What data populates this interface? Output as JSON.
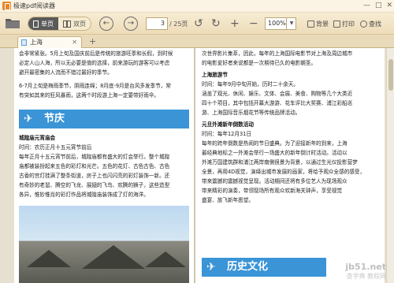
{
  "app": {
    "title": "极速pdf阅读器",
    "win_controls": [
      "—",
      "□",
      "✕"
    ]
  },
  "toolbar": {
    "view_single": "单页",
    "view_double": "双页",
    "page_current": "3",
    "page_total": "/ 25页",
    "zoom": "100%",
    "background_label": "背景",
    "print_label": "打印",
    "search_label": "查找"
  },
  "tabs": [
    {
      "label": "上海"
    }
  ],
  "doc": {
    "left_lines": [
      "会非常紧张。5月上旬及国庆前后是传统的旅游旺季和长假，到时候",
      "必定人山人海，所以无必要是值的选择，前来游玩的游客可以考虑",
      "避开最密集的人流而不错过最好的季节。",
      "6-7月上旬是梅雨季节，阴雨连绵；8月底-9月是台风多发季节，常",
      "有突如其来的狂风暴雨，这两个时段游上海一定要带好雨伞。"
    ],
    "left_section_title": "节庆",
    "festival_name": "城隍庙元宵庙会",
    "festival_lines": [
      "时间：农历正月十五元宵节前后",
      "每年正月十五元宵节前后，城隍庙都有盛大的灯会举行。整个城隍",
      "庙都被装扮起来五色的彩灯和光芒。五色的花灯、古色古色、古色",
      "古香的宫灯挂满了整条街道，房子上也闪闪亮的彩灯装饰一新。还",
      "有奇妙的老鼠、腾空的飞龙、展翅的飞鸟、欢腾的狮子，这些造型",
      "各异，惟妙惟肖的彩灯作品将城隍庙装饰成了灯的海洋。"
    ],
    "right_lines": [
      "次世界影片集萃，因此，每年的上海国际电影节对上海及周边城市",
      "的电影爱好者来说都是一次期待已久的电影朝圣。"
    ],
    "tourism_title": "上海旅游节",
    "tourism_lines": [
      "时间：每年9月中旬开始，历时二十余天。",
      "涵盖了观光、休闲、娱乐、文体、会展、美食、购物等几个大类近",
      "四十个项目，其中包括开幕大游游、花车评比大奖赛、浦江彩船巡",
      "游、上海国际音乐烟花节等传统品牌活动。"
    ],
    "countdown_title": "元旦外滩新年倒数活动",
    "countdown_lines": [
      "时间：每年12月31日",
      "每年的跨年倒数是热闹的节日盛典。为了迎接新年的到来，上海",
      "最经典地标之一外滩会举行一场盛大的新年倒计时活动。活动以",
      "外滩万国建筑群和浦江两岸南側很景为背景，以通过生光仪投影营梦",
      "全景，再用4D视觉，演绎出城市发展的画家，将给予观众全感的感受，",
      "带来震撼的震撼视觉呈现。活动期间还将有多位艺人为现场观众",
      "带来精彩的演奏，带领现场所有观众欢新海关钟声，享受视觉",
      "盛宴、放飞新年愿望。"
    ],
    "right_section_title": "历史文化"
  },
  "watermark": {
    "line1": "jb51.net",
    "line2": "查字典 教程网"
  }
}
